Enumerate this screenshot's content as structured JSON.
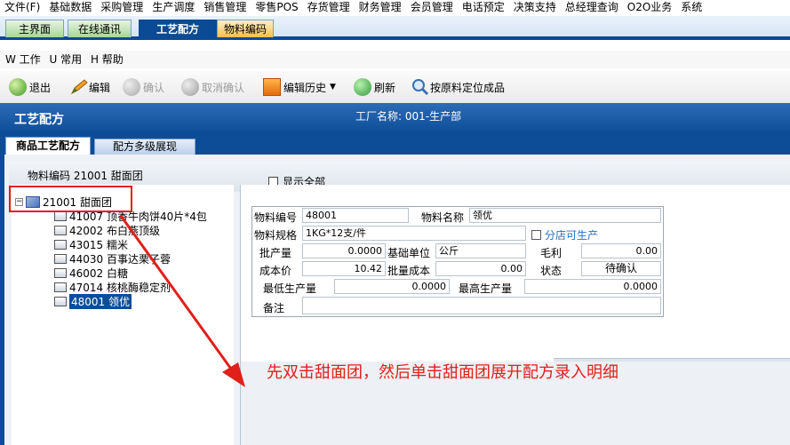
{
  "top_menu": [
    "文件(F)",
    "基础数据",
    "采购管理",
    "生产调度",
    "销售管理",
    "零售POS",
    "存货管理",
    "财务管理",
    "会员管理",
    "电话预定",
    "决策支持",
    "总经理查询",
    "O2O业务",
    "系统"
  ],
  "tabs": {
    "main": "主界面",
    "online": "在线通讯",
    "recipe": "工艺配方",
    "material": "物料编码"
  },
  "sub_menu": [
    "W 工作",
    "U 常用",
    "H 帮助"
  ],
  "toolbar": {
    "exit": "退出",
    "edit": "编辑",
    "confirm": "确认",
    "cancel_confirm": "取消确认",
    "edit_history": "编辑历史",
    "refresh": "刷新",
    "locate": "按原料定位成品"
  },
  "header": {
    "title": "工艺配方",
    "factory": "工厂名称: 001-生产部"
  },
  "subtabs": {
    "recipe": "商品工艺配方",
    "multi": "配方多级展现"
  },
  "filter": {
    "material_code": "物料编码 21001 甜面团",
    "show_all": "显示全部"
  },
  "tree": {
    "root": "21001 甜面团",
    "children": [
      "41007 顶香牛肉饼40片*4包",
      "42002 布白燕顶级",
      "43015 糯米",
      "44030 百事达栗子蓉",
      "46002 白糖",
      "47014 核桃酶稳定剂",
      "48001 领优"
    ]
  },
  "form": {
    "code_label": "物料编号",
    "code": "48001",
    "name_label": "物料名称",
    "name": "领优",
    "spec_label": "物料规格",
    "spec": "1KG*12支/件",
    "branch_label": "分店可生产",
    "batch_label": "批产量",
    "batch": "0.0000",
    "unit_label": "基础单位",
    "unit": "公斤",
    "profit_label": "毛利",
    "profit": "0.00",
    "cost_label": "成本价",
    "cost": "10.42",
    "batch_cost_label": "批量成本",
    "batch_cost": "0.00",
    "status_label": "状态",
    "status": "待确认",
    "min_label": "最低生产量",
    "min": "0.0000",
    "max_label": "最高生产量",
    "max": "0.0000",
    "note_label": "备注",
    "note": ""
  },
  "annotation": "先双击甜面团，然后单击甜面团展开配方录入明细",
  "colors": {
    "accent": "#0d4d98",
    "annotation": "#e0201a"
  }
}
